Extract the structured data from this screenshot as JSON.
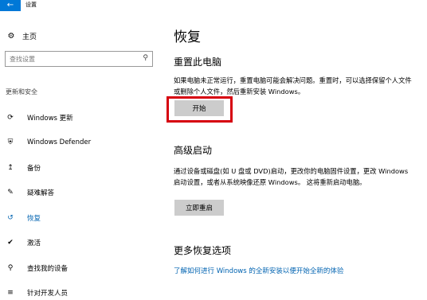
{
  "window": {
    "title": "设置",
    "back_icon": "back-arrow-icon"
  },
  "sidebar": {
    "home_label": "主页",
    "search_placeholder": "查找设置",
    "section_title": "更新和安全",
    "items": [
      {
        "label": "Windows 更新",
        "icon": "sync-icon"
      },
      {
        "label": "Windows Defender",
        "icon": "shield-icon"
      },
      {
        "label": "备份",
        "icon": "backup-icon"
      },
      {
        "label": "疑难解答",
        "icon": "wrench-icon"
      },
      {
        "label": "恢复",
        "icon": "recovery-icon",
        "active": true
      },
      {
        "label": "激活",
        "icon": "check-circle-icon"
      },
      {
        "label": "查找我的设备",
        "icon": "find-device-icon"
      },
      {
        "label": "针对开发人员",
        "icon": "developer-icon"
      }
    ]
  },
  "main": {
    "title": "恢复",
    "reset": {
      "heading": "重置此电脑",
      "description": "如果电脑未正常运行，重置电脑可能会解决问题。重置时，可以选择保留个人文件或删除个人文件，然后重新安装 Windows。",
      "button": "开始"
    },
    "advanced": {
      "heading": "高级启动",
      "description": "通过设备或磁盘(如 U 盘或 DVD)启动，更改你的电脑固件设置，更改 Windows 启动设置，或者从系统映像还原 Windows。 这将重新启动电脑。",
      "button": "立即重启"
    },
    "more": {
      "heading": "更多恢复选项",
      "link": "了解如何进行 Windows 的全新安装以便开始全新的体验"
    }
  },
  "colors": {
    "accent": "#0078d7",
    "highlight": "#d6000f",
    "button": "#cccccc",
    "link": "#0063b1"
  }
}
